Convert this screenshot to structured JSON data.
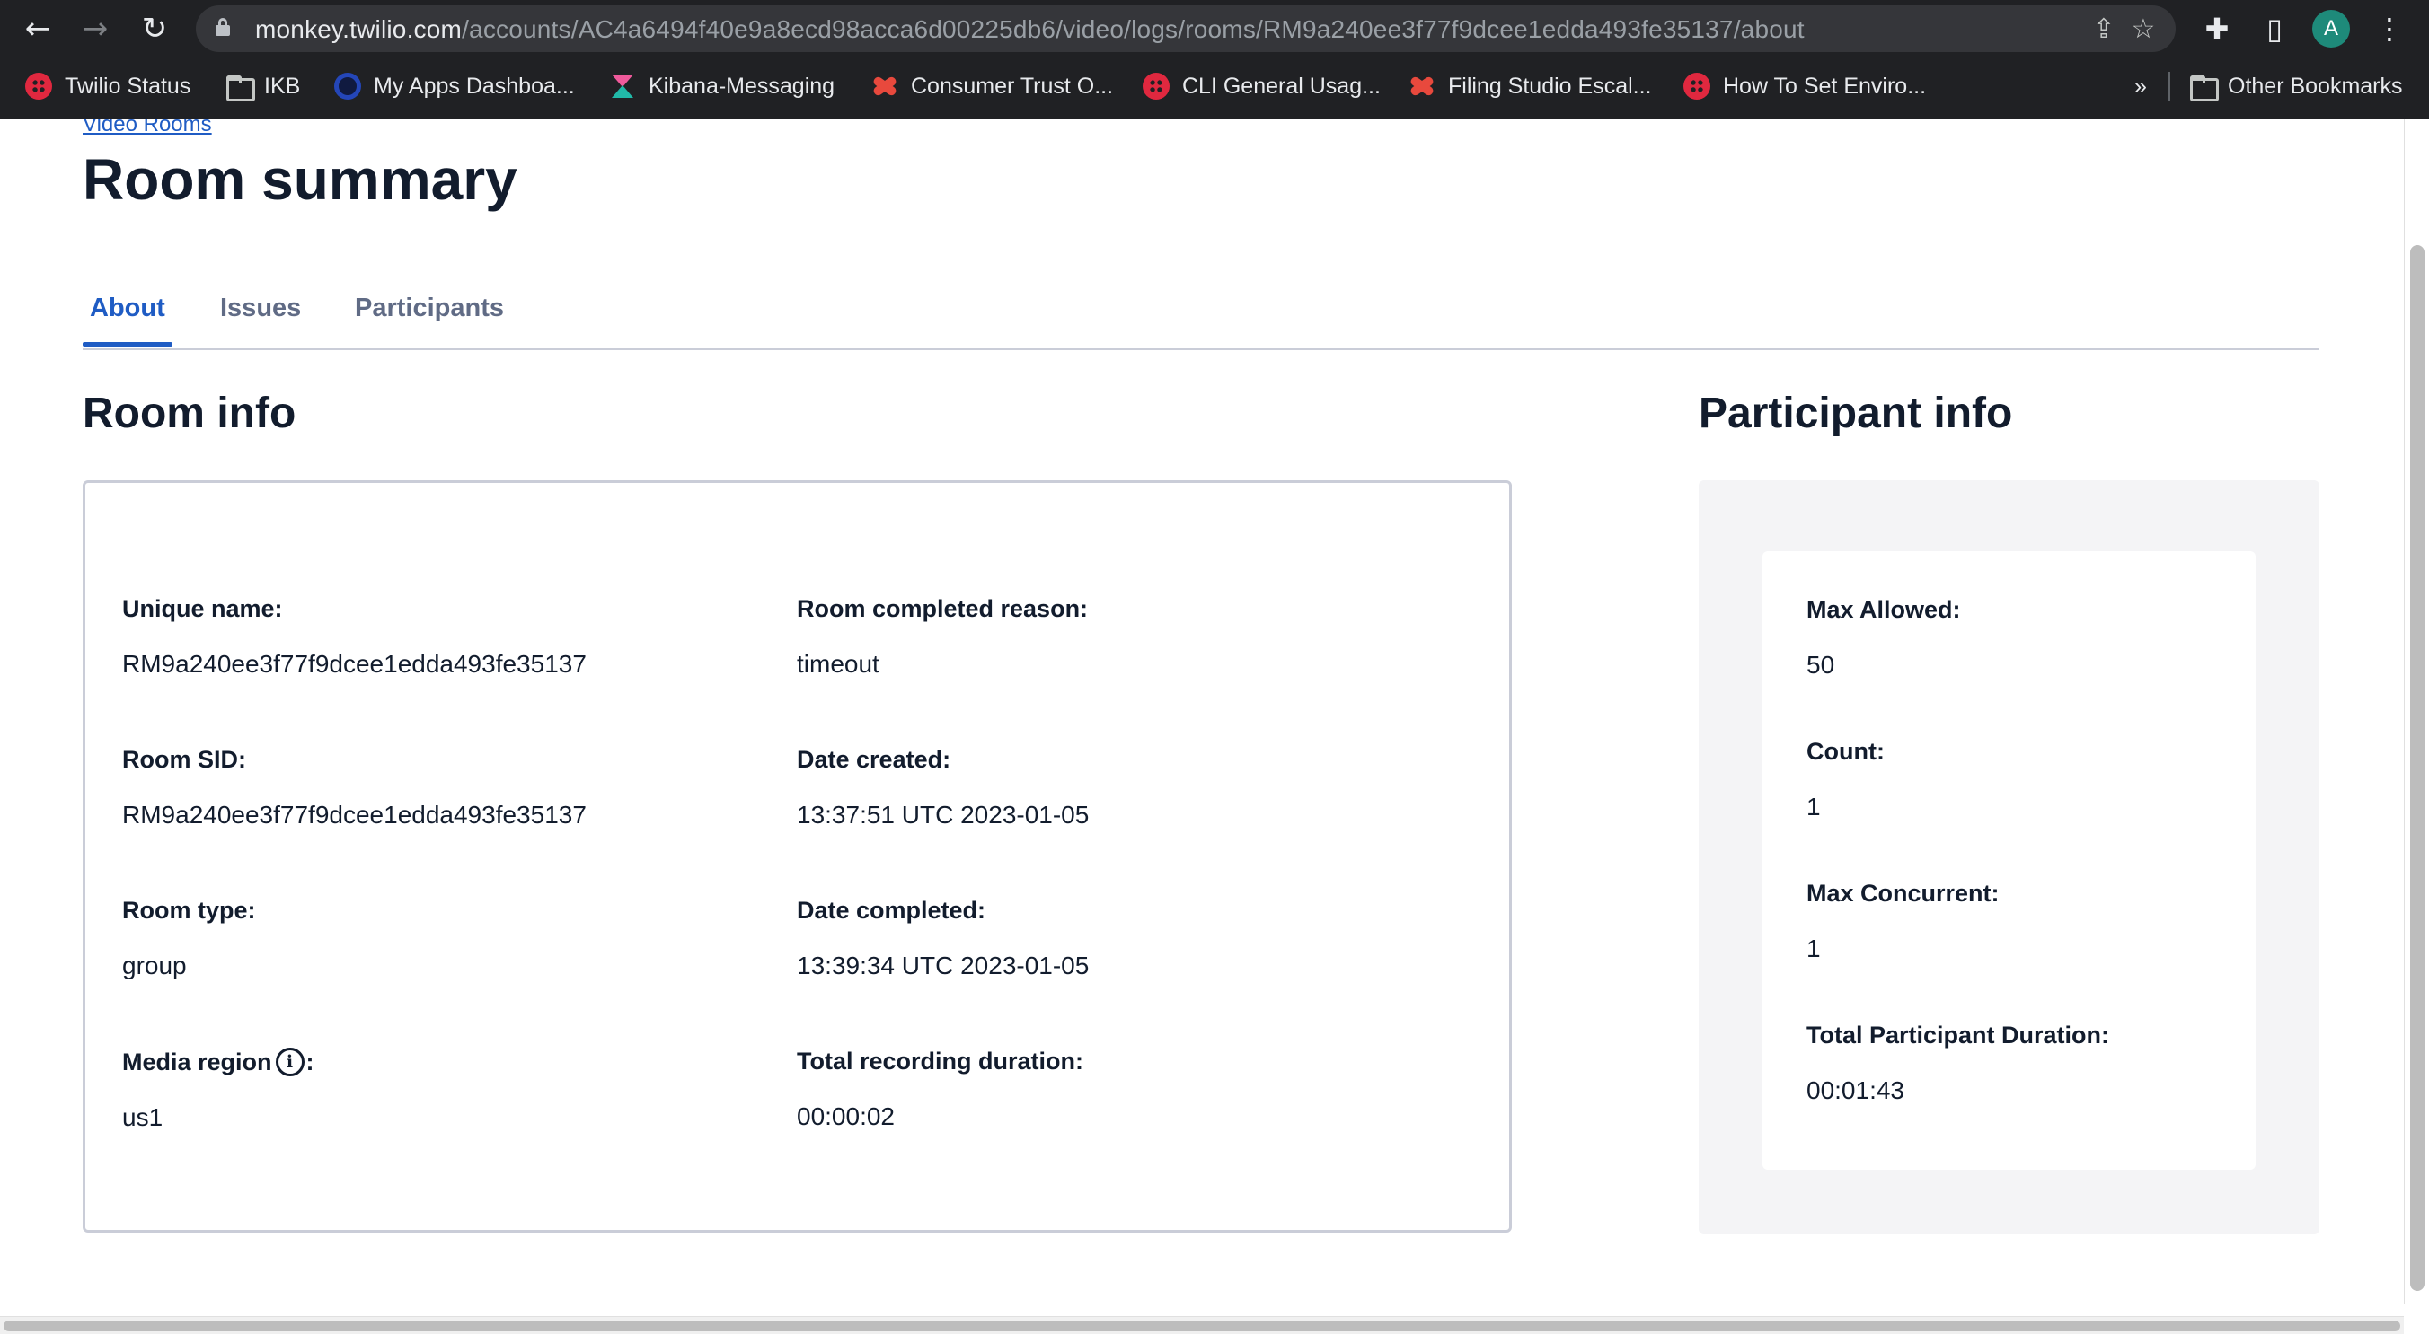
{
  "browser": {
    "url_host": "monkey.twilio.com",
    "url_path": "/accounts/AC4a6494f40e9a8ecd98acca6d00225db6/video/logs/rooms/RM9a240ee3f77f9dcee1edda493fe35137/about",
    "avatar_initial": "A",
    "icons": {
      "back": "back-arrow-icon",
      "forward": "forward-arrow-icon",
      "reload": "reload-icon",
      "share": "share-icon",
      "bookmark": "star-icon",
      "extensions": "puzzle-icon",
      "side_panel": "side-panel-icon",
      "menu": "kebab-menu-icon"
    },
    "bookmarks": [
      {
        "label": "Twilio Status",
        "icon": "twilio-icon"
      },
      {
        "label": "IKB",
        "icon": "folder-icon"
      },
      {
        "label": "My Apps Dashboa...",
        "icon": "okta-icon"
      },
      {
        "label": "Kibana-Messaging",
        "icon": "kibana-icon"
      },
      {
        "label": "Consumer Trust O...",
        "icon": "confluence-icon"
      },
      {
        "label": "CLI General Usag...",
        "icon": "twilio-icon"
      },
      {
        "label": "Filing Studio Escal...",
        "icon": "confluence-icon"
      },
      {
        "label": "How To Set Enviro...",
        "icon": "twilio-icon"
      }
    ],
    "overflow_label": "»",
    "other_bookmarks": "Other Bookmarks"
  },
  "page": {
    "breadcrumb": "Video Rooms",
    "title": "Room summary",
    "tabs": [
      {
        "label": "About",
        "active": true
      },
      {
        "label": "Issues",
        "active": false
      },
      {
        "label": "Participants",
        "active": false
      }
    ]
  },
  "room_info": {
    "title": "Room info",
    "fields": {
      "unique_name": {
        "label": "Unique name:",
        "value": "RM9a240ee3f77f9dcee1edda493fe35137"
      },
      "room_sid": {
        "label": "Room SID:",
        "value": "RM9a240ee3f77f9dcee1edda493fe35137"
      },
      "room_type": {
        "label": "Room type:",
        "value": "group"
      },
      "media_region": {
        "label": "Media region",
        "label_suffix": ":",
        "value": "us1"
      },
      "completed_reason": {
        "label": "Room completed reason:",
        "value": "timeout"
      },
      "date_created": {
        "label": "Date created:",
        "value": "13:37:51 UTC 2023-01-05"
      },
      "date_completed": {
        "label": "Date completed:",
        "value": "13:39:34 UTC 2023-01-05"
      },
      "recording_duration": {
        "label": "Total recording duration:",
        "value": "00:00:02"
      }
    }
  },
  "participant_info": {
    "title": "Participant info",
    "fields": {
      "max_allowed": {
        "label": "Max Allowed:",
        "value": "50"
      },
      "count": {
        "label": "Count:",
        "value": "1"
      },
      "max_concurrent": {
        "label": "Max Concurrent:",
        "value": "1"
      },
      "total_duration": {
        "label": "Total Participant Duration:",
        "value": "00:01:43"
      }
    }
  },
  "colors": {
    "chrome_bg": "#202124",
    "accent_blue": "#1f5cc4",
    "heading": "#121c2d",
    "panel_bg": "#f4f4f6"
  }
}
